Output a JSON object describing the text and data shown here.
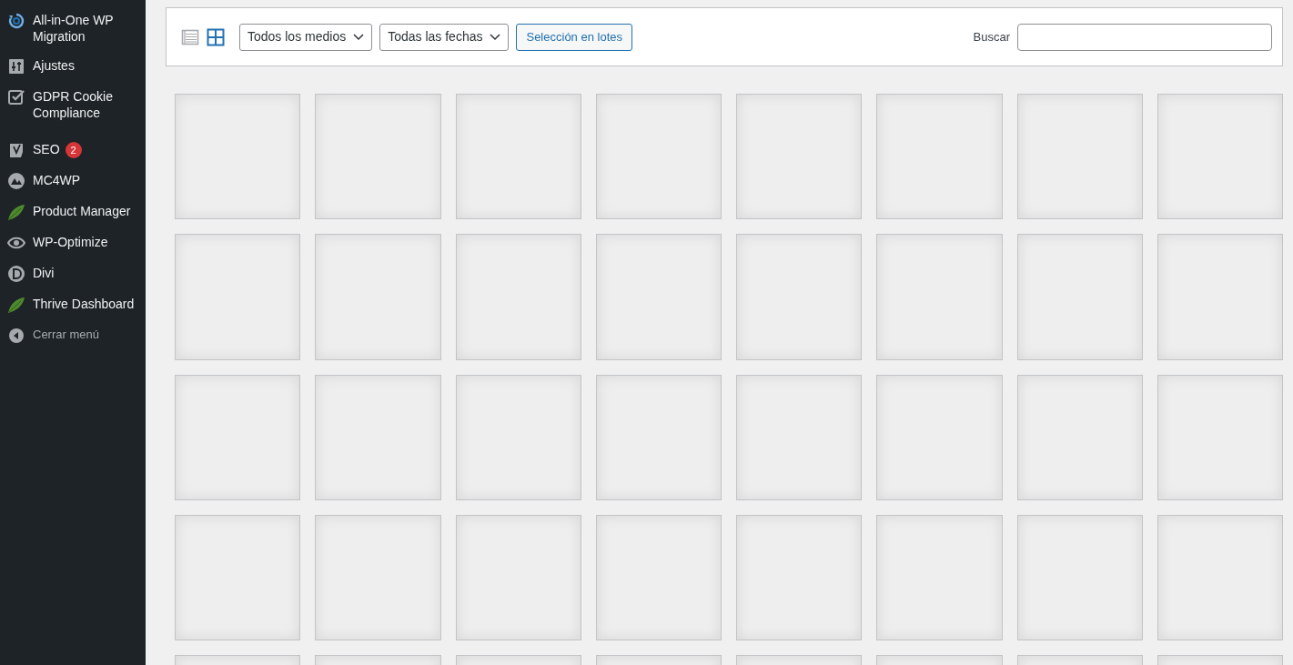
{
  "sidebar": {
    "items": [
      {
        "label": "All-in-One WP Migration",
        "selected": false
      },
      {
        "label": "Ajustes",
        "selected": false
      },
      {
        "label": "GDPR Cookie Compliance",
        "selected": false
      },
      {
        "label": "SEO",
        "badge": "2",
        "selected": false
      },
      {
        "label": "MC4WP",
        "selected": false
      },
      {
        "label": "Product Manager",
        "selected": false
      },
      {
        "label": "WP-Optimize",
        "selected": false
      },
      {
        "label": "Divi",
        "selected": false
      },
      {
        "label": "Thrive Dashboard",
        "selected": false
      },
      {
        "label": "Cerrar menú",
        "kind": "collapse",
        "selected": false
      }
    ]
  },
  "toolbar": {
    "views": [
      {
        "kind": "list",
        "selected": false
      },
      {
        "kind": "grid",
        "selected": true
      }
    ],
    "filters": [
      {
        "value": "Todos los medios"
      },
      {
        "value": "Todas las fechas"
      }
    ],
    "bulk_button": "Selección en lotes",
    "search": {
      "label": "Buscar"
    }
  },
  "media_grid": {
    "tiles": [
      {
        "kind": "placeholder"
      },
      {
        "kind": "placeholder"
      },
      {
        "kind": "placeholder"
      },
      {
        "kind": "placeholder"
      },
      {
        "kind": "placeholder"
      },
      {
        "kind": "placeholder"
      },
      {
        "kind": "placeholder"
      },
      {
        "kind": "placeholder"
      },
      {
        "kind": "placeholder"
      },
      {
        "kind": "placeholder"
      },
      {
        "kind": "placeholder"
      },
      {
        "kind": "placeholder"
      },
      {
        "kind": "placeholder"
      },
      {
        "kind": "placeholder"
      },
      {
        "kind": "placeholder"
      },
      {
        "kind": "placeholder"
      },
      {
        "kind": "placeholder"
      },
      {
        "kind": "placeholder"
      },
      {
        "kind": "placeholder"
      },
      {
        "kind": "placeholder"
      },
      {
        "kind": "placeholder"
      },
      {
        "kind": "placeholder"
      },
      {
        "kind": "placeholder"
      },
      {
        "kind": "placeholder"
      },
      {
        "kind": "placeholder"
      },
      {
        "kind": "placeholder"
      },
      {
        "kind": "placeholder"
      },
      {
        "kind": "placeholder"
      },
      {
        "kind": "placeholder"
      },
      {
        "kind": "placeholder"
      },
      {
        "kind": "placeholder"
      },
      {
        "kind": "placeholder"
      },
      {
        "kind": "placeholder"
      },
      {
        "kind": "placeholder"
      },
      {
        "kind": "placeholder"
      },
      {
        "kind": "placeholder"
      },
      {
        "kind": "placeholder"
      },
      {
        "kind": "placeholder"
      },
      {
        "kind": "placeholder"
      },
      {
        "kind": "placeholder"
      }
    ]
  }
}
